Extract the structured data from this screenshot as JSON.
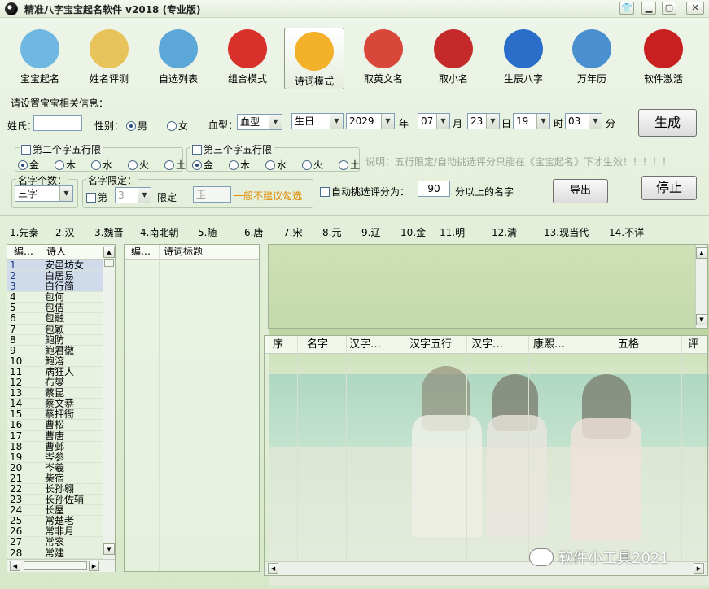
{
  "window": {
    "title": "精准八字宝宝起名软件 v2018 (专业版)"
  },
  "toolbar": [
    {
      "label": "宝宝起名",
      "icon": "baby-face-icon",
      "color": "#6fb6e0"
    },
    {
      "label": "姓名评测",
      "icon": "score-100-icon",
      "color": "#e8c35a"
    },
    {
      "label": "自选列表",
      "icon": "bird-book-icon",
      "color": "#5aa7d8"
    },
    {
      "label": "组合模式",
      "icon": "lantern-icon",
      "color": "#d8302a"
    },
    {
      "label": "诗词模式",
      "icon": "open-book-icon",
      "color": "#f3b12a"
    },
    {
      "label": "取英文名",
      "icon": "phoenix-icon",
      "color": "#d9473a"
    },
    {
      "label": "取小名",
      "icon": "monkey-face-icon",
      "color": "#c52a2a"
    },
    {
      "label": "生辰八字",
      "icon": "yin-yang-icon",
      "color": "#2a6ec9"
    },
    {
      "label": "万年历",
      "icon": "calendar-365-icon",
      "color": "#4a90d0"
    },
    {
      "label": "软件激活",
      "icon": "lock-icon",
      "color": "#c82020"
    }
  ],
  "form": {
    "section_label": "请设置宝宝相关信息：",
    "surname_label": "姓氏：",
    "surname_value": "",
    "gender_label": "性别：",
    "gender_male": "男",
    "gender_female": "女",
    "blood_label": "血型：",
    "blood_value": "血型",
    "birth_value": "生日",
    "year_value": "2029",
    "year_unit": "年",
    "month_value": "07",
    "month_unit": "月",
    "day_value": "23",
    "day_unit": "日",
    "hour_value": "19",
    "hour_unit": "时",
    "minute_value": "03",
    "minute_unit": "分",
    "generate_button": "生成",
    "second_wuxing_label": "第二个字五行限",
    "third_wuxing_label": "第三个字五行限",
    "elements": [
      "金",
      "木",
      "水",
      "火",
      "土"
    ],
    "note": "说明：五行限定/自动挑选评分只能在《宝宝起名》下才生效！！！！！",
    "name_count_label": "名字个数：",
    "name_count_value": "三字",
    "name_limit_label": "名字限定：",
    "limit_position_label": "第",
    "limit_position_value": "3",
    "limit_label": "限定",
    "limit_char_value": "玉",
    "limit_hint": "一般不建议勾选",
    "auto_score_label": "自动挑选评分为：",
    "auto_score_value": "90",
    "auto_score_suffix": "分以上的名字",
    "export_button": "导出",
    "stop_button": "停止"
  },
  "dynasties": [
    "1.先秦",
    "2.汉",
    "3.魏晋",
    "4.南北朝",
    "5.随",
    "6.唐",
    "7.宋",
    "8.元",
    "9.辽",
    "10.金",
    "11.明",
    "12.清",
    "13.现当代",
    "14.不详"
  ],
  "poets_table": {
    "headers": [
      "编…",
      "诗人"
    ],
    "rows": [
      [
        "1",
        "安邑坊女"
      ],
      [
        "2",
        "白居易"
      ],
      [
        "3",
        "白行简"
      ],
      [
        "4",
        "包何"
      ],
      [
        "5",
        "包佶"
      ],
      [
        "6",
        "包融"
      ],
      [
        "7",
        "包颖"
      ],
      [
        "8",
        "鲍防"
      ],
      [
        "9",
        "鲍君徽"
      ],
      [
        "10",
        "鲍溶"
      ],
      [
        "11",
        "病狂人"
      ],
      [
        "12",
        "布燮"
      ],
      [
        "13",
        "蔡昆"
      ],
      [
        "14",
        "蔡文恭"
      ],
      [
        "15",
        "蔡押衙"
      ],
      [
        "16",
        "曹松"
      ],
      [
        "17",
        "曹唐"
      ],
      [
        "18",
        "曹邺"
      ],
      [
        "19",
        "岑参"
      ],
      [
        "20",
        "岑羲"
      ],
      [
        "21",
        "柴宿"
      ],
      [
        "22",
        "长孙翱"
      ],
      [
        "23",
        "长孙佐辅"
      ],
      [
        "24",
        "长屋"
      ],
      [
        "25",
        "常楚老"
      ],
      [
        "26",
        "常非月"
      ],
      [
        "27",
        "常衮"
      ],
      [
        "28",
        "常建"
      ]
    ]
  },
  "poems_table": {
    "headers": [
      "编…",
      "诗词标题"
    ]
  },
  "results_table": {
    "headers": [
      "序",
      "名字",
      "汉字…",
      "汉字五行",
      "汉字…",
      "康熙…",
      "五格",
      "评"
    ]
  },
  "watermark": "软件小工具2021"
}
